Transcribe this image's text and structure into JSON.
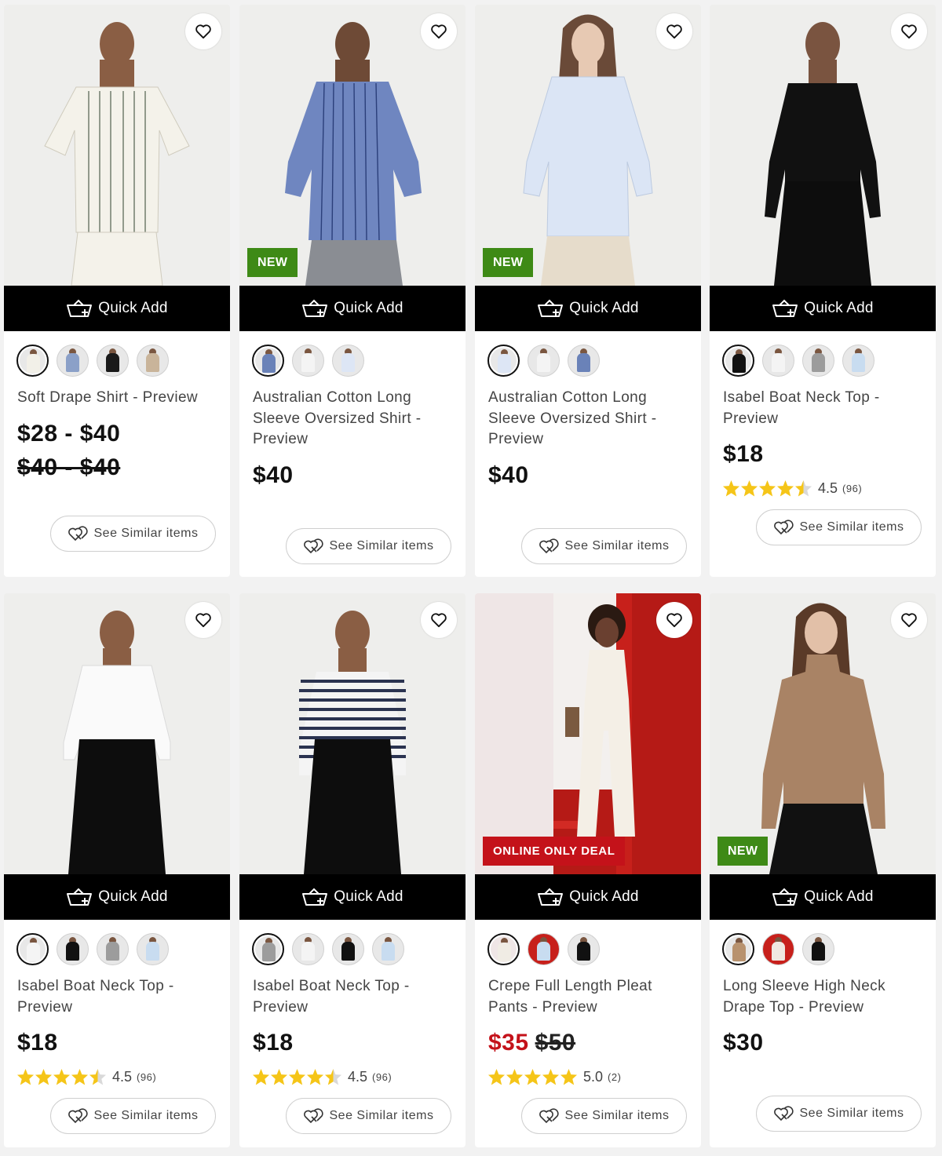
{
  "common": {
    "quick_add_label": "Quick Add",
    "see_similar_label": "See Similar items",
    "icons": {
      "wishlist": "heart-outline-icon",
      "quick_add": "shopping-basket-plus-icon",
      "similar": "double-heart-outline-icon",
      "star": "star-filled-icon"
    },
    "colors": {
      "new_badge": "#3e8a16",
      "deal_badge": "#c4121a",
      "sale_price": "#c4121a",
      "star": "#f5c518",
      "quick_add_bg": "#000000"
    }
  },
  "products": [
    {
      "name": "Soft Drape Shirt - Preview",
      "price": "$28 - $40",
      "was_price": "$40 - $40",
      "badge": "",
      "swatches": [
        "#f2f0e8",
        "#8ba0c8",
        "#1a1a1a",
        "#c9b49a"
      ]
    },
    {
      "name": "Australian Cotton Long Sleeve Oversized Shirt - Preview",
      "price": "$40",
      "badge": "NEW",
      "swatches": [
        "#6a82b8",
        "#f4f4f4",
        "#dde6f5"
      ]
    },
    {
      "name": "Australian Cotton Long Sleeve Oversized Shirt - Preview",
      "price": "$40",
      "badge": "NEW",
      "swatches": [
        "#dde6f5",
        "#f4f4f4",
        "#6a82b8"
      ]
    },
    {
      "name": "Isabel Boat Neck Top - Preview",
      "price": "$18",
      "rating": {
        "value": "4.5",
        "count": "(96)",
        "stars": 4.5
      },
      "badge": "",
      "swatches": [
        "#111111",
        "#f4f4f4",
        "#9c9c9c",
        "#c8dcf0"
      ]
    },
    {
      "name": "Isabel Boat Neck Top - Preview",
      "price": "$18",
      "rating": {
        "value": "4.5",
        "count": "(96)",
        "stars": 4.5
      },
      "badge": "",
      "swatches": [
        "#f4f4f4",
        "#111111",
        "#9c9c9c",
        "#c8dcf0"
      ]
    },
    {
      "name": "Isabel Boat Neck Top - Preview",
      "price": "$18",
      "rating": {
        "value": "4.5",
        "count": "(96)",
        "stars": 4.5
      },
      "badge": "",
      "swatches": [
        "#9c9c9c",
        "#f4f4f4",
        "#111111",
        "#c8dcf0"
      ]
    },
    {
      "name": "Crepe Full Length Pleat Pants - Preview",
      "price": "$35",
      "was_price": "$50",
      "on_sale": true,
      "rating": {
        "value": "5.0",
        "count": "(2)",
        "stars": 5
      },
      "badge": "ONLINE ONLY DEAL",
      "swatches": [
        "#f0ece4",
        "#c8dcf0",
        "#111111"
      ]
    },
    {
      "name": "Long Sleeve High Neck Drape Top - Preview",
      "price": "$30",
      "badge": "NEW",
      "swatches": [
        "#b8926e",
        "#f0e8e0",
        "#111111"
      ]
    }
  ]
}
